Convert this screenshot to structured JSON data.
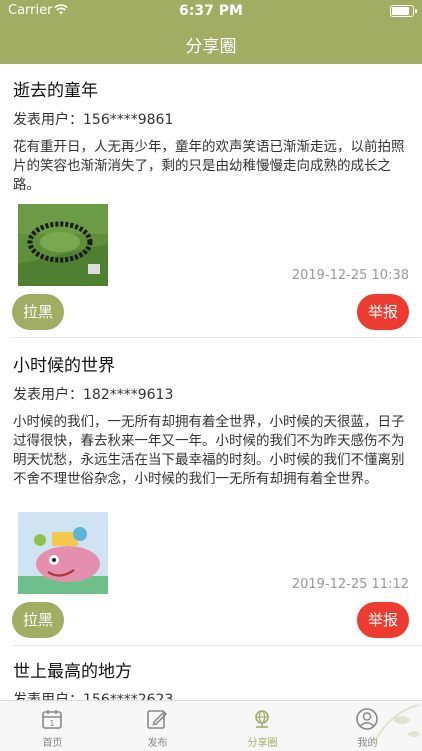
{
  "status_bar": {
    "carrier": "Carrier",
    "time": "6:37 PM"
  },
  "nav": {
    "title": "分享圈"
  },
  "colors": {
    "accent": "#a0ad63",
    "report": "#ee3b2f"
  },
  "posts": [
    {
      "title": "逝去的童年",
      "user_label": "发表用户：156****9861",
      "body": "花有重开日，人无再少年，童年的欢声笑语已渐渐走远，以前拍照片的笑容也渐渐消失了，剩的只是由幼稚慢慢走向成熟的成长之路。",
      "time": "2019-12-25 10:38",
      "block_label": "拉黑",
      "report_label": "举报"
    },
    {
      "title": "小时候的世界",
      "user_label": "发表用户：182****9613",
      "body": "小时候的我们，一无所有却拥有着全世界，小时候的天很蓝，日子过得很快，春去秋来一年又一年。小时候的我们不为昨天感伤不为明天忧愁，永远生活在当下最幸福的时刻。小时候的我们不懂离别不舍不理世俗杂念，小时候的我们一无所有却拥有着全世界。",
      "time": "2019-12-25 11:12",
      "block_label": "拉黑",
      "report_label": "举报"
    },
    {
      "title": "世上最高的地方",
      "user_label": "发表用户：156****2623"
    }
  ],
  "tabs": [
    {
      "label": "首页",
      "icon": "calendar-icon"
    },
    {
      "label": "发布",
      "icon": "edit-icon"
    },
    {
      "label": "分享圈",
      "icon": "globe-icon",
      "active": true
    },
    {
      "label": "我的",
      "icon": "user-icon"
    }
  ]
}
